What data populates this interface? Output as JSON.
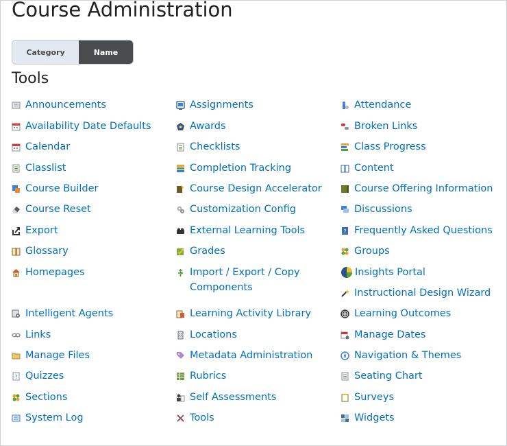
{
  "page_title": "Course Administration",
  "toggle": {
    "category_label": "Category",
    "name_label": "Name",
    "selected": "Name"
  },
  "section_title": "Tools",
  "link_color": "#006fbf",
  "tools": {
    "col1": [
      {
        "label": "Announcements",
        "icon": "announcements-icon"
      },
      {
        "label": "Availability Date Defaults",
        "icon": "calendar-icon"
      },
      {
        "label": "Calendar",
        "icon": "calendar-icon"
      },
      {
        "label": "Classlist",
        "icon": "classlist-icon"
      },
      {
        "label": "Course Builder",
        "icon": "course-builder-icon"
      },
      {
        "label": "Course Reset",
        "icon": "eraser-icon"
      },
      {
        "label": "Export",
        "icon": "export-icon"
      },
      {
        "label": "Glossary",
        "icon": "book-icon"
      },
      {
        "label": "Homepages",
        "icon": "home-icon"
      },
      {
        "label": "Intelligent Agents",
        "icon": "agent-icon"
      },
      {
        "label": "Links",
        "icon": "link-icon"
      },
      {
        "label": "Manage Files",
        "icon": "folder-icon"
      },
      {
        "label": "Quizzes",
        "icon": "quiz-icon"
      },
      {
        "label": "Sections",
        "icon": "sections-icon"
      },
      {
        "label": "System Log",
        "icon": "log-icon"
      }
    ],
    "col2": [
      {
        "label": "Assignments",
        "icon": "assignments-icon"
      },
      {
        "label": "Awards",
        "icon": "award-icon"
      },
      {
        "label": "Checklists",
        "icon": "checklist-icon"
      },
      {
        "label": "Completion Tracking",
        "icon": "tracking-icon"
      },
      {
        "label": "Course Design Accelerator",
        "icon": "accelerator-icon"
      },
      {
        "label": "Customization Config",
        "icon": "gears-icon"
      },
      {
        "label": "External Learning Tools",
        "icon": "puzzle-icon"
      },
      {
        "label": "Grades",
        "icon": "grades-icon"
      },
      {
        "label": "Import / Export / Copy Components",
        "icon": "import-export-icon"
      },
      {
        "label": "Learning Activity Library",
        "icon": "library-icon"
      },
      {
        "label": "Locations",
        "icon": "building-icon"
      },
      {
        "label": "Metadata Administration",
        "icon": "tag-icon"
      },
      {
        "label": "Rubrics",
        "icon": "rubric-icon"
      },
      {
        "label": "Self Assessments",
        "icon": "self-assessment-icon"
      },
      {
        "label": "Tools",
        "icon": "tools-icon"
      }
    ],
    "col3": [
      {
        "label": "Attendance",
        "icon": "attendance-icon"
      },
      {
        "label": "Broken Links",
        "icon": "broken-link-icon"
      },
      {
        "label": "Class Progress",
        "icon": "progress-icon"
      },
      {
        "label": "Content",
        "icon": "content-icon"
      },
      {
        "label": "Course Offering Information",
        "icon": "offering-icon"
      },
      {
        "label": "Discussions",
        "icon": "discussion-icon"
      },
      {
        "label": "Frequently Asked Questions",
        "icon": "faq-icon"
      },
      {
        "label": "Groups",
        "icon": "groups-icon"
      },
      {
        "label": "Insights Portal",
        "icon": "insights-icon"
      },
      {
        "label": "Instructional Design Wizard",
        "icon": "wand-icon"
      },
      {
        "label": "Learning Outcomes",
        "icon": "outcomes-icon"
      },
      {
        "label": "Manage Dates",
        "icon": "manage-dates-icon"
      },
      {
        "label": "Navigation & Themes",
        "icon": "compass-icon"
      },
      {
        "label": "Seating Chart",
        "icon": "seating-icon"
      },
      {
        "label": "Surveys",
        "icon": "survey-icon"
      },
      {
        "label": "Widgets",
        "icon": "widgets-icon"
      }
    ]
  }
}
